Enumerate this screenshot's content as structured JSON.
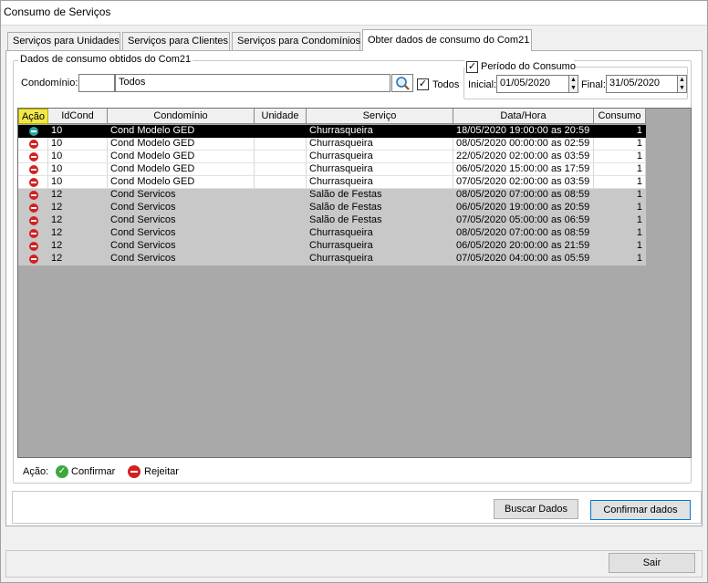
{
  "window": {
    "title": "Consumo de Serviços"
  },
  "tabs": [
    {
      "label": "Serviços para Unidades"
    },
    {
      "label": "Serviços para Clientes"
    },
    {
      "label": "Serviços para Condomínios"
    },
    {
      "label": "Obter dados de consumo do Com21"
    }
  ],
  "group": {
    "title": "Dados de consumo obtidos do Com21"
  },
  "filter": {
    "condominio_label": "Condomínio:",
    "condominio_code": "",
    "condominio_name": "Todos",
    "todos_label": "Todos",
    "todos_checked": "✓",
    "search_icon": "magnifier-icon"
  },
  "periodo": {
    "label": "Período do Consumo",
    "checked": "✓",
    "inicial_label": "Inicial:",
    "inicial_value": "01/05/2020",
    "final_label": "Final:",
    "final_value": "31/05/2020"
  },
  "grid": {
    "columns": [
      "Ação",
      "IdCond",
      "Condomínio",
      "Unidade",
      "Serviço",
      "Data/Hora",
      "Consumo"
    ],
    "rows": [
      {
        "acao": "dash",
        "idcond": "10",
        "condominio": "Cond Modelo GED",
        "unidade": "",
        "servico": "Churrasqueira",
        "datahora": "18/05/2020 19:00:00 as 20:59",
        "consumo": "1"
      },
      {
        "acao": "reject",
        "idcond": "10",
        "condominio": "Cond Modelo GED",
        "unidade": "",
        "servico": "Churrasqueira",
        "datahora": "08/05/2020 00:00:00 as 02:59",
        "consumo": "1"
      },
      {
        "acao": "reject",
        "idcond": "10",
        "condominio": "Cond Modelo GED",
        "unidade": "",
        "servico": "Churrasqueira",
        "datahora": "22/05/2020 02:00:00 as 03:59",
        "consumo": "1"
      },
      {
        "acao": "reject",
        "idcond": "10",
        "condominio": "Cond Modelo GED",
        "unidade": "",
        "servico": "Churrasqueira",
        "datahora": "06/05/2020 15:00:00 as 17:59",
        "consumo": "1"
      },
      {
        "acao": "reject",
        "idcond": "10",
        "condominio": "Cond Modelo GED",
        "unidade": "",
        "servico": "Churrasqueira",
        "datahora": "07/05/2020 02:00:00 as 03:59",
        "consumo": "1"
      },
      {
        "acao": "reject",
        "idcond": "12",
        "condominio": "Cond Servicos",
        "unidade": "",
        "servico": "Salão de Festas",
        "datahora": "08/05/2020 07:00:00 as 08:59",
        "consumo": "1"
      },
      {
        "acao": "reject",
        "idcond": "12",
        "condominio": "Cond Servicos",
        "unidade": "",
        "servico": "Salão de Festas",
        "datahora": "06/05/2020 19:00:00 as 20:59",
        "consumo": "1"
      },
      {
        "acao": "reject",
        "idcond": "12",
        "condominio": "Cond Servicos",
        "unidade": "",
        "servico": "Salão de Festas",
        "datahora": "07/05/2020 05:00:00 as 06:59",
        "consumo": "1"
      },
      {
        "acao": "reject",
        "idcond": "12",
        "condominio": "Cond Servicos",
        "unidade": "",
        "servico": "Churrasqueira",
        "datahora": "08/05/2020 07:00:00 as 08:59",
        "consumo": "1"
      },
      {
        "acao": "reject",
        "idcond": "12",
        "condominio": "Cond Servicos",
        "unidade": "",
        "servico": "Churrasqueira",
        "datahora": "06/05/2020 20:00:00 as 21:59",
        "consumo": "1"
      },
      {
        "acao": "reject",
        "idcond": "12",
        "condominio": "Cond Servicos",
        "unidade": "",
        "servico": "Churrasqueira",
        "datahora": "07/05/2020 04:00:00 as 05:59",
        "consumo": "1"
      }
    ]
  },
  "legend": {
    "label": "Ação:",
    "confirm_label": "Confirmar",
    "reject_label": "Rejeitar",
    "confirm_glyph": "✓"
  },
  "buttons": {
    "buscar": "Buscar Dados",
    "confirmar": "Confirmar dados",
    "sair": "Sair"
  },
  "colors": {
    "selected_row": "#000000",
    "gray_rows": "#c8c8c8",
    "header_highlight": "#f0e84a",
    "reject_icon": "#d42020",
    "confirm_icon": "#3da83d"
  }
}
